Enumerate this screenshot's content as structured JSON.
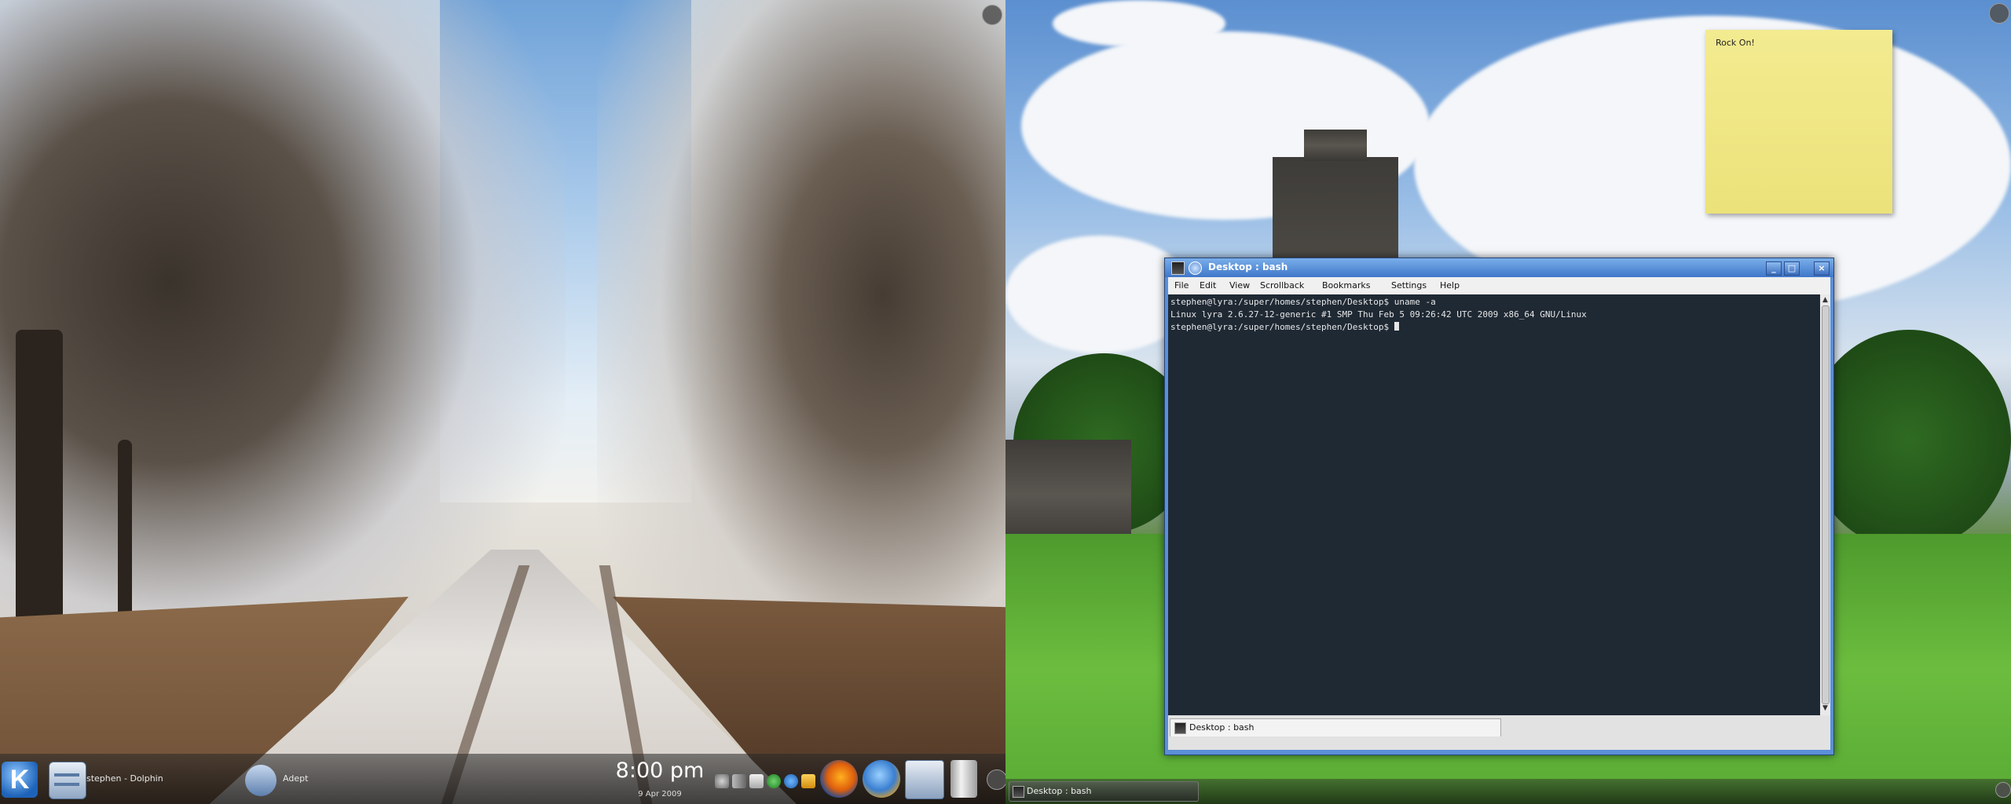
{
  "left_panel": {
    "tasks": [
      {
        "label": "stephen - Dolphin"
      },
      {
        "label": "Adept"
      }
    ],
    "clock": {
      "time": "8:00 pm",
      "date": "9 Apr 2009"
    }
  },
  "sticky_note": {
    "text": "Rock On!"
  },
  "terminal": {
    "title": "Desktop : bash",
    "menu": [
      "File",
      "Edit",
      "View",
      "Scrollback",
      "Bookmarks",
      "Settings",
      "Help"
    ],
    "lines": [
      "stephen@lyra:/super/homes/stephen/Desktop$ uname -a",
      "Linux lyra 2.6.27-12-generic #1 SMP Thu Feb 5 09:26:42 UTC 2009 x86_64 GNU/Linux",
      "stephen@lyra:/super/homes/stephen/Desktop$ "
    ],
    "tab_label": "Desktop : bash",
    "window_buttons": {
      "minimize": "_",
      "maximize": "□",
      "close": "×"
    }
  },
  "right_panel": {
    "taskbar_item": "Desktop : bash"
  }
}
